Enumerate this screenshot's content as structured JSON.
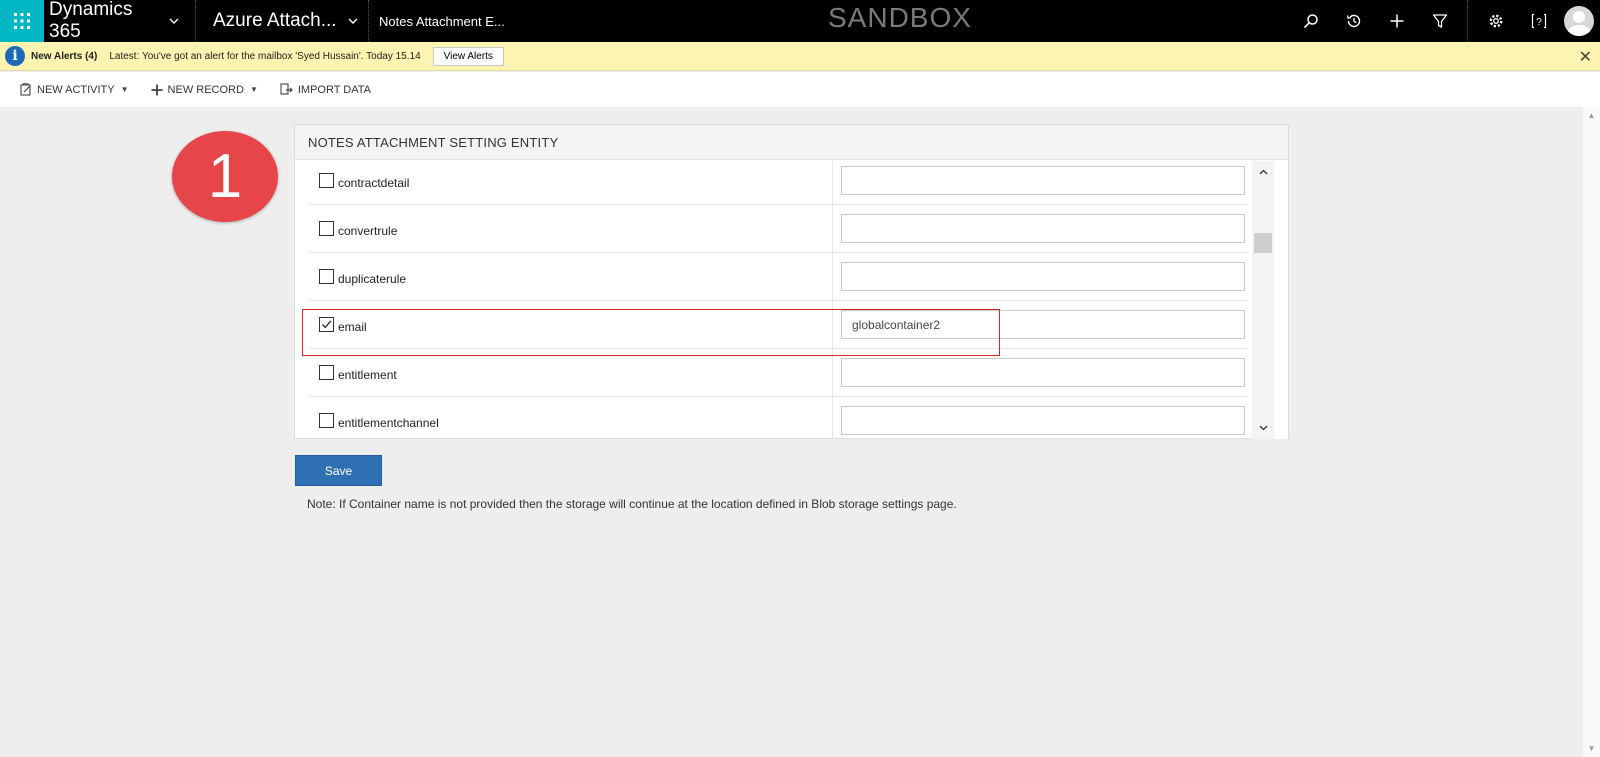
{
  "topbar": {
    "app_name": "Dynamics 365",
    "area_name": "Azure Attach...",
    "breadcrumb": "Notes Attachment E...",
    "environment": "SANDBOX",
    "accent_color": "#00b7c3"
  },
  "alerts": {
    "title": "New Alerts (4)",
    "message": "Latest: You've got an alert for the mailbox 'Syed Hussain'. Today 15.14",
    "button_label": "View Alerts"
  },
  "commands": {
    "new_activity": "NEW ACTIVITY",
    "new_record": "NEW RECORD",
    "import_data": "IMPORT DATA"
  },
  "step_badge": "1",
  "panel": {
    "title": "NOTES ATTACHMENT SETTING ENTITY",
    "rows": [
      {
        "entity": "contractdetail",
        "checked": false,
        "container": ""
      },
      {
        "entity": "convertrule",
        "checked": false,
        "container": ""
      },
      {
        "entity": "duplicaterule",
        "checked": false,
        "container": ""
      },
      {
        "entity": "email",
        "checked": true,
        "container": "globalcontainer2"
      },
      {
        "entity": "entitlement",
        "checked": false,
        "container": ""
      },
      {
        "entity": "entitlementchannel",
        "checked": false,
        "container": ""
      }
    ]
  },
  "save_label": "Save",
  "note": "Note: If Container name is not provided then the storage will continue at the location defined in Blob storage settings page."
}
